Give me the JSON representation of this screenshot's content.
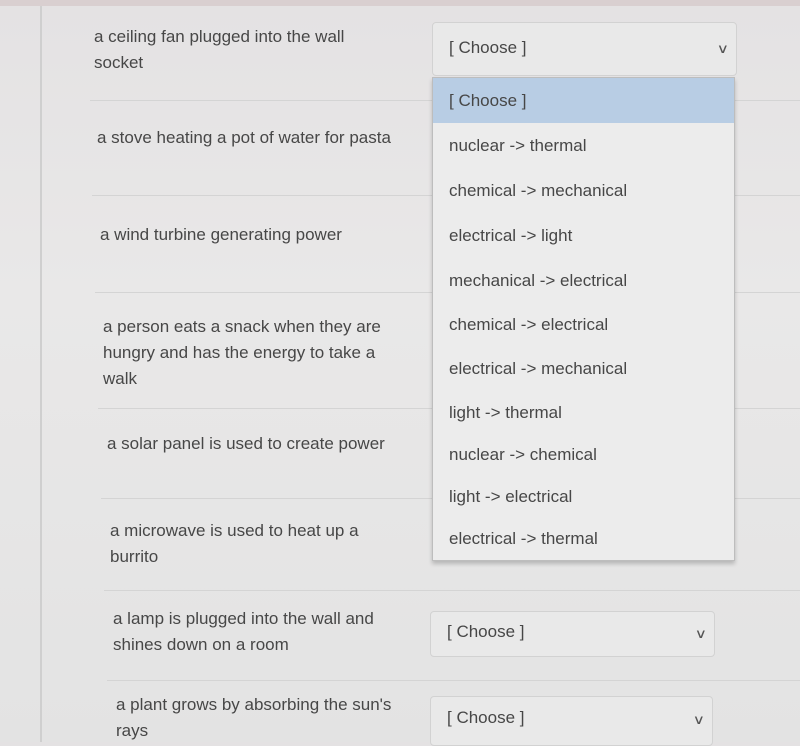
{
  "prompts": [
    "a ceiling fan plugged into the wall socket",
    "a stove heating a pot of water for pasta",
    "a wind turbine generating power",
    "a person eats a snack when they are hungry and has the energy to take a walk",
    "a solar panel is used to create power",
    "a microwave is used to heat up a burrito",
    "a lamp is plugged into the wall and shines down on a room",
    "a plant grows by absorbing the sun's rays"
  ],
  "selects": {
    "open_value": "[ Choose ]",
    "lamp_value": "[ Choose ]",
    "plant_value": "[ Choose ]"
  },
  "options": [
    "[ Choose ]",
    "nuclear -> thermal",
    "chemical -> mechanical",
    "electrical -> light",
    "mechanical -> electrical",
    "chemical -> electrical",
    "electrical -> mechanical",
    "light -> thermal",
    "nuclear -> chemical",
    "light -> electrical",
    "electrical -> thermal"
  ],
  "highlight_color": "#b8cde4"
}
